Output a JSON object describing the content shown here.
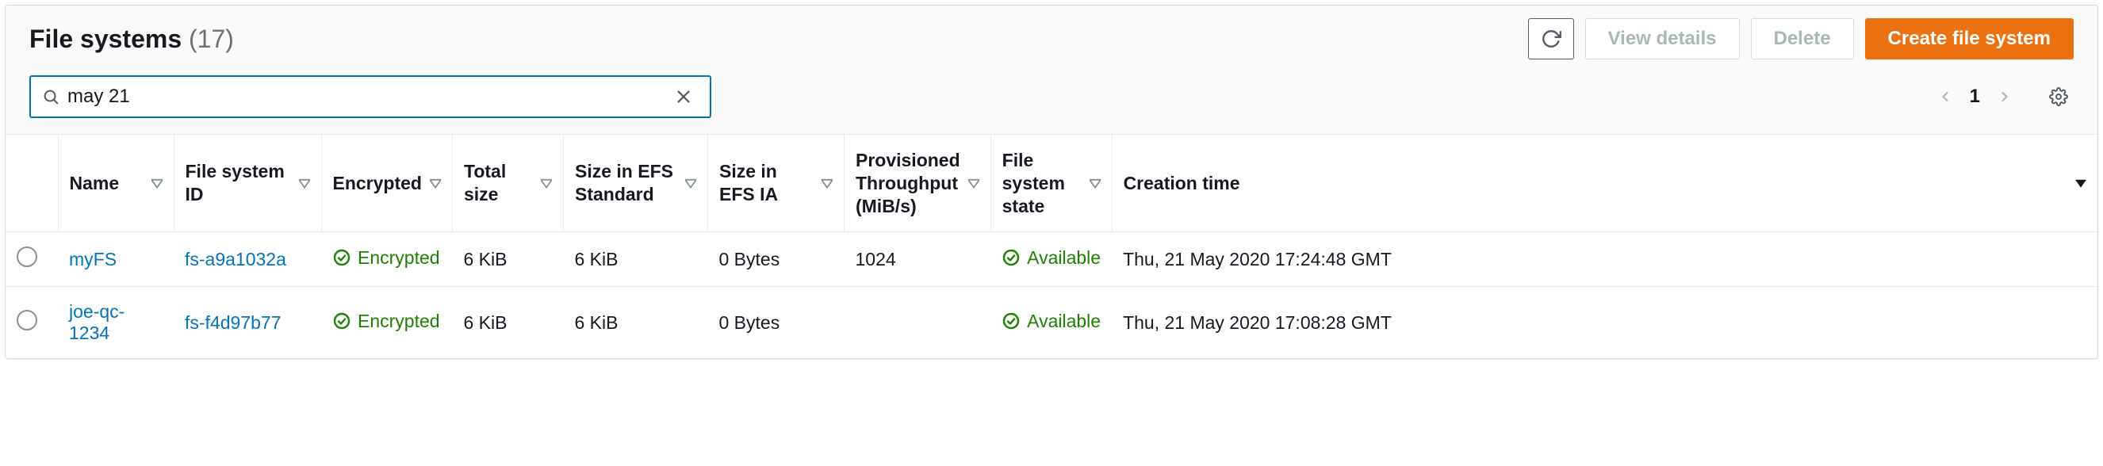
{
  "header": {
    "title": "File systems",
    "count_display": "(17)",
    "buttons": {
      "view_details": "View details",
      "delete": "Delete",
      "create": "Create file system"
    }
  },
  "search": {
    "value": "may 21"
  },
  "pager": {
    "current": "1"
  },
  "columns": {
    "name": "Name",
    "fs_id": "File system ID",
    "encrypted": "Encrypted",
    "total_size": "Total size",
    "size_std": "Size in EFS Standard",
    "size_ia": "Size in EFS IA",
    "throughput": "Provisioned Throughput (MiB/s)",
    "state": "File system state",
    "creation": "Creation time"
  },
  "rows": [
    {
      "name": "myFS",
      "fs_id": "fs-a9a1032a",
      "encrypted": "Encrypted",
      "total_size": "6 KiB",
      "size_std": "6 KiB",
      "size_ia": "0 Bytes",
      "throughput": "1024",
      "state": "Available",
      "creation": "Thu, 21 May 2020 17:24:48 GMT"
    },
    {
      "name": "joe-qc-1234",
      "fs_id": "fs-f4d97b77",
      "encrypted": "Encrypted",
      "total_size": "6 KiB",
      "size_std": "6 KiB",
      "size_ia": "0 Bytes",
      "throughput": "",
      "state": "Available",
      "creation": "Thu, 21 May 2020 17:08:28 GMT"
    }
  ]
}
